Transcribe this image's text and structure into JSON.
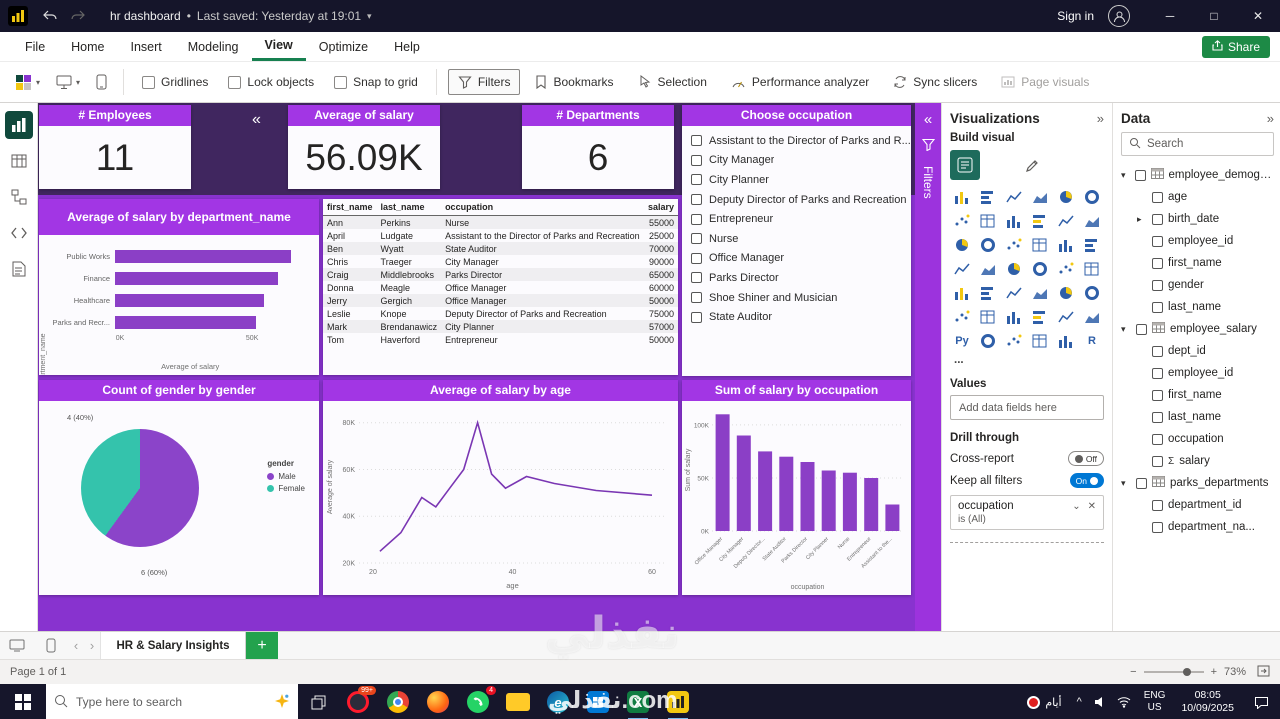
{
  "watermark": {
    "main": "نفذلي",
    "site": "نفذلي.com"
  },
  "titlebar": {
    "title": "hr dashboard",
    "separator": "•",
    "saved": "Last saved: Yesterday at 19:01",
    "sign_in": "Sign in"
  },
  "menubar": {
    "items": [
      "File",
      "Home",
      "Insert",
      "Modeling",
      "View",
      "Optimize",
      "Help"
    ],
    "active_item": "View",
    "share": "Share"
  },
  "ribbon": {
    "checkboxes": [
      {
        "label": "Gridlines",
        "checked": false
      },
      {
        "label": "Lock objects",
        "checked": false
      },
      {
        "label": "Snap to grid",
        "checked": false
      }
    ],
    "buttons": [
      {
        "label": "Filters",
        "icon": "funnel-icon",
        "active": true,
        "disabled": false
      },
      {
        "label": "Bookmarks",
        "icon": "bookmark-icon",
        "active": false,
        "disabled": false
      },
      {
        "label": "Selection",
        "icon": "selection-icon",
        "active": false,
        "disabled": false
      },
      {
        "label": "Performance analyzer",
        "icon": "performance-icon",
        "active": false,
        "disabled": false
      },
      {
        "label": "Sync slicers",
        "icon": "sync-icon",
        "active": false,
        "disabled": false
      },
      {
        "label": "Page visuals",
        "icon": "page-visuals-icon",
        "active": false,
        "disabled": true
      }
    ]
  },
  "left_rail": [
    {
      "name": "report-view",
      "active": true
    },
    {
      "name": "table-view",
      "active": false
    },
    {
      "name": "model-view",
      "active": false
    },
    {
      "name": "dax-query-view",
      "active": false
    },
    {
      "name": "tmdl-view",
      "active": false
    }
  ],
  "canvas": {
    "cards": [
      {
        "title": "# Employees",
        "value": "11"
      },
      {
        "title": "Average of salary",
        "value": "56.09K"
      },
      {
        "title": "# Departments",
        "value": "6"
      }
    ],
    "slicer": {
      "title": "Choose occupation",
      "items": [
        "Assistant to the Director of Parks and R...",
        "City Manager",
        "City Planner",
        "Deputy Director of Parks and Recreation",
        "Entrepreneur",
        "Nurse",
        "Office Manager",
        "Parks Director",
        "Shoe Shiner and Musician",
        "State Auditor"
      ]
    },
    "table": {
      "columns": [
        "first_name",
        "last_name",
        "occupation",
        "salary"
      ],
      "rows": [
        [
          "Ann",
          "Perkins",
          "Nurse",
          "55000"
        ],
        [
          "April",
          "Ludgate",
          "Assistant to the Director of Parks and Recreation",
          "25000"
        ],
        [
          "Ben",
          "Wyatt",
          "State Auditor",
          "70000"
        ],
        [
          "Chris",
          "Traeger",
          "City Manager",
          "90000"
        ],
        [
          "Craig",
          "Middlebrooks",
          "Parks Director",
          "65000"
        ],
        [
          "Donna",
          "Meagle",
          "Office Manager",
          "60000"
        ],
        [
          "Jerry",
          "Gergich",
          "Office Manager",
          "50000"
        ],
        [
          "Leslie",
          "Knope",
          "Deputy Director of Parks and Recreation",
          "75000"
        ],
        [
          "Mark",
          "Brendanawicz",
          "City Planner",
          "57000"
        ],
        [
          "Tom",
          "Haverford",
          "Entrepreneur",
          "50000"
        ]
      ]
    }
  },
  "chart_data": [
    {
      "type": "bar",
      "orientation": "horizontal",
      "title": "Average of salary by department_name",
      "categories": [
        "Public Works",
        "Finance",
        "Healthcare",
        "Parks and Recr..."
      ],
      "values": [
        65000,
        60000,
        55000,
        52000
      ],
      "xlabel": "Average of salary",
      "ylabel": "department_name",
      "xlim": [
        0,
        70000
      ],
      "xticks": [
        "0K",
        "50K"
      ],
      "xtick_values": [
        0,
        50000
      ],
      "bar_color": "#8b3fc6"
    },
    {
      "type": "pie",
      "title": "Count of gender by gender",
      "legend_title": "gender",
      "slices": [
        {
          "label": "Male",
          "count": 6,
          "pct": 60,
          "display": "6 (60%)",
          "color": "#8b44c9"
        },
        {
          "label": "Female",
          "count": 4,
          "pct": 40,
          "display": "4 (40%)",
          "color": "#34c3ac"
        }
      ]
    },
    {
      "type": "line",
      "title": "Average of salary by age",
      "x": [
        21,
        24,
        27,
        29,
        31,
        33,
        35,
        37,
        39,
        42,
        46,
        52,
        60
      ],
      "y": [
        25000,
        33000,
        48000,
        44000,
        52000,
        60000,
        80000,
        58000,
        52000,
        57000,
        54000,
        51000,
        49000
      ],
      "xlabel": "age",
      "ylabel": "Average of salary",
      "xlim": [
        18,
        62
      ],
      "ylim": [
        20000,
        85000
      ],
      "yticks": [
        "20K",
        "40K",
        "60K",
        "80K"
      ],
      "ytick_values": [
        20000,
        40000,
        60000,
        80000
      ],
      "xticks": [
        "20",
        "40",
        "60"
      ],
      "xtick_values": [
        20,
        40,
        60
      ],
      "line_color": "#7a36b3"
    },
    {
      "type": "bar",
      "orientation": "vertical",
      "title": "Sum of salary by occupation",
      "categories": [
        "Office Manager",
        "City Manager",
        "Deputy Director...",
        "State Auditor",
        "Parks Director",
        "City Planner",
        "Nurse",
        "Entrepreneur",
        "Assistant to the..."
      ],
      "values": [
        110000,
        90000,
        75000,
        70000,
        65000,
        57000,
        55000,
        50000,
        25000
      ],
      "xlabel": "occupation",
      "ylabel": "Sum of salary",
      "ylim": [
        0,
        115000
      ],
      "yticks": [
        "0K",
        "50K",
        "100K"
      ],
      "ytick_values": [
        0,
        50000,
        100000
      ],
      "bar_color": "#8b3fc6"
    }
  ],
  "filters_pane_collapsed": {
    "label": "Filters"
  },
  "viz_pane": {
    "title": "Visualizations",
    "build_visual": "Build visual",
    "values_label": "Values",
    "values_placeholder": "Add data fields here",
    "drill_through": "Drill through",
    "cross_report": "Cross-report",
    "cross_report_state": "Off",
    "keep_all_filters": "Keep all filters",
    "keep_all_filters_state": "On",
    "drill_field": {
      "name": "occupation",
      "condition": "is (All)"
    },
    "more": "..."
  },
  "data_pane": {
    "title": "Data",
    "search_placeholder": "Search",
    "tables": [
      {
        "name": "employee_demograph...",
        "fields": [
          {
            "name": "age"
          },
          {
            "name": "birth_date",
            "expandable": true
          },
          {
            "name": "employee_id"
          },
          {
            "name": "first_name"
          },
          {
            "name": "gender"
          },
          {
            "name": "last_name"
          }
        ]
      },
      {
        "name": "employee_salary",
        "fields": [
          {
            "name": "dept_id"
          },
          {
            "name": "employee_id"
          },
          {
            "name": "first_name"
          },
          {
            "name": "last_name"
          },
          {
            "name": "occupation"
          },
          {
            "name": "salary",
            "sigma": true
          }
        ]
      },
      {
        "name": "parks_departments",
        "fields": [
          {
            "name": "department_id"
          },
          {
            "name": "department_na..."
          }
        ]
      }
    ]
  },
  "page_tabs": {
    "active_tab": "HR & Salary Insights"
  },
  "status_bar": {
    "page_info": "Page 1 of 1",
    "zoom": "73%"
  },
  "taskbar": {
    "search_placeholder": "Type here to search",
    "apps": [
      {
        "name": "opera",
        "badge": "99+"
      },
      {
        "name": "chrome",
        "badge": ""
      },
      {
        "name": "firefox",
        "badge": ""
      },
      {
        "name": "whatsapp",
        "badge": "4"
      },
      {
        "name": "file-explorer",
        "badge": ""
      },
      {
        "name": "edge",
        "badge": ""
      },
      {
        "name": "store",
        "badge": ""
      },
      {
        "name": "excel",
        "badge": ""
      },
      {
        "name": "power-bi",
        "badge": ""
      }
    ],
    "tray_app": "أيام",
    "language": "ENG",
    "region": "US",
    "time": "08:05",
    "date": "10/09/2025"
  }
}
